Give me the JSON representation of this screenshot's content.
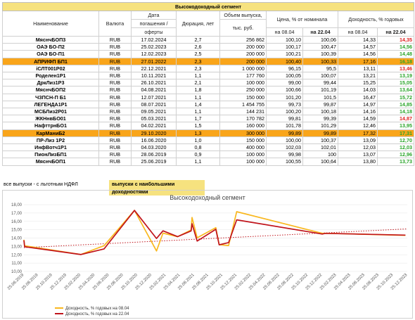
{
  "table": {
    "title": "Высокодоходный сегмент",
    "headers": {
      "name": "Наименование",
      "currency": "Валюта",
      "maturity_l1": "Дата",
      "maturity_l2": "погашения /",
      "maturity_l3": "оферты",
      "duration": "Дюрация, лет",
      "volume_l1": "Объем выпуска,",
      "volume_l2": "тыс. руб.",
      "price": "Цена, % от номинала",
      "price_d1": "на 08.04",
      "price_d2": "на 22.04",
      "yield": "Доходность, % годовых",
      "yield_d1": "на 08.04",
      "yield_d2": "на 22.04"
    },
    "rows": [
      {
        "name": "МяснчБОП3",
        "cur": "RUB",
        "date": "17.02.2024",
        "dur": "2,7",
        "vol": "256 862",
        "p1": "100,10",
        "p2": "100,06",
        "y1": "14,33",
        "y2": "14,35",
        "dir": "down",
        "hl": false
      },
      {
        "name": "ОАЭ  БО-П2",
        "cur": "RUB",
        "date": "25.02.2023",
        "dur": "2,6",
        "vol": "200 000",
        "p1": "100,17",
        "p2": "100,47",
        "y1": "14,57",
        "y2": "14,56",
        "dir": "up",
        "hl": false
      },
      {
        "name": "ОАЭ  БО-П1",
        "cur": "RUB",
        "date": "12.02.2023",
        "dur": "2,5",
        "vol": "200 000",
        "p1": "100,21",
        "p2": "100,39",
        "y1": "14,56",
        "y2": "14,48",
        "dir": "up",
        "hl": false
      },
      {
        "name": "АПРИФП БП1",
        "cur": "RUB",
        "date": "27.01.2022",
        "dur": "2,3",
        "vol": "200 000",
        "p1": "100,40",
        "p2": "100,33",
        "y1": "17,16",
        "y2": "16,18",
        "dir": "up",
        "hl": true
      },
      {
        "name": "iСЛТ001Р02",
        "cur": "RUB",
        "date": "22.12.2021",
        "dur": "2,3",
        "vol": "1 000 000",
        "p1": "96,15",
        "p2": "95,5",
        "y1": "13,11",
        "y2": "13,46",
        "dir": "down",
        "hl": false
      },
      {
        "name": "Роделен1Р1",
        "cur": "RUB",
        "date": "10.11.2021",
        "dur": "1,1",
        "vol": "177 760",
        "p1": "100,05",
        "p2": "100,07",
        "y1": "13,21",
        "y2": "13,19",
        "dir": "up",
        "hl": false
      },
      {
        "name": "ДркЛиз1Р3",
        "cur": "RUB",
        "date": "26.10.2021",
        "dur": "2,1",
        "vol": "100 000",
        "p1": "99,00",
        "p2": "99,44",
        "y1": "15,25",
        "y2": "15,05",
        "dir": "up",
        "hl": false
      },
      {
        "name": "МяснчБОП2",
        "cur": "RUB",
        "date": "04.08.2021",
        "dur": "1,8",
        "vol": "250 000",
        "p1": "100,66",
        "p2": "101,19",
        "y1": "14,03",
        "y2": "13,64",
        "dir": "up",
        "hl": false
      },
      {
        "name": "ЧЗПСН-П Б1",
        "cur": "RUB",
        "date": "12.07.2021",
        "dur": "1,1",
        "vol": "150 000",
        "p1": "101,20",
        "p2": "101,5",
        "y1": "16,47",
        "y2": "15,72",
        "dir": "up",
        "hl": false
      },
      {
        "name": "ЛЕГЕНДА1Р1",
        "cur": "RUB",
        "date": "08.07.2021",
        "dur": "1,4",
        "vol": "1 454 755",
        "p1": "99,73",
        "p2": "99,87",
        "y1": "14,97",
        "y2": "14,85",
        "dir": "up",
        "hl": false
      },
      {
        "name": "МСБЛиз2Р01",
        "cur": "RUB",
        "date": "09.05.2021",
        "dur": "1,1",
        "vol": "144 231",
        "p1": "100,20",
        "p2": "100,18",
        "y1": "14,16",
        "y2": "14,18",
        "dir": "up",
        "hl": false
      },
      {
        "name": "ЖКНнвБО01",
        "cur": "RUB",
        "date": "05.03.2021",
        "dur": "1,7",
        "vol": "170 782",
        "p1": "99,81",
        "p2": "99,39",
        "y1": "14,59",
        "y2": "14,87",
        "dir": "down",
        "hl": false
      },
      {
        "name": "НафттрнБО1",
        "cur": "RUB",
        "date": "04.02.2021",
        "dur": "1,5",
        "vol": "160 000",
        "p1": "101,78",
        "p2": "101,29",
        "y1": "12,46",
        "y2": "13,95",
        "dir": "up",
        "hl": false
      },
      {
        "name": "КарМаниБ2",
        "cur": "RUB",
        "date": "29.10.2020",
        "dur": "1,3",
        "vol": "300 000",
        "p1": "99,89",
        "p2": "99,89",
        "y1": "17,32",
        "y2": "17,31",
        "dir": "up",
        "hl": true
      },
      {
        "name": "ПР-Лиз 1Р2",
        "cur": "RUB",
        "date": "16.06.2020",
        "dur": "1,0",
        "vol": "150 000",
        "p1": "100,00",
        "p2": "100,37",
        "y1": "13,09",
        "y2": "12,70",
        "dir": "up",
        "hl": false
      },
      {
        "name": "ИнфВотч1Р1",
        "cur": "RUB",
        "date": "04.03.2020",
        "dur": "0,8",
        "vol": "400 000",
        "p1": "102,03",
        "p2": "102,01",
        "y1": "12,03",
        "y2": "12,03",
        "dir": "up",
        "hl": false
      },
      {
        "name": "ПионЛизБП1",
        "cur": "RUB",
        "date": "28.06.2019",
        "dur": "0,9",
        "vol": "100 000",
        "p1": "99,98",
        "p2": "100",
        "y1": "13,07",
        "y2": "12,96",
        "dir": "up",
        "hl": false
      },
      {
        "name": "МяснчБОП1",
        "cur": "RUB",
        "date": "25.06.2019",
        "dur": "1,1",
        "vol": "100 000",
        "p1": "100,55",
        "p2": "100,64",
        "y1": "13,80",
        "y2": "13,73",
        "dir": "up",
        "hl": false
      }
    ]
  },
  "notes": {
    "left": "все выпуски - с льготным НДФЛ",
    "right": "выпуски с наибольшими доходностями"
  },
  "colors": {
    "title_bg": "#f6e27f",
    "highlight": "#f9a51a",
    "up": "#2aa52a",
    "down": "#e02020",
    "line1": "#f9b81f",
    "line2": "#c0141b",
    "trend": "#c0141b"
  },
  "chart_data": {
    "type": "line",
    "title": "Высокодоходный сегмент",
    "ylim": [
      10,
      18
    ],
    "yticks": [
      "10,00",
      "11,00",
      "12,00",
      "13,00",
      "14,00",
      "15,00",
      "16,00",
      "17,00",
      "18,00"
    ],
    "xticks": [
      "25.06.2019",
      "25.08.2019",
      "25.10.2019",
      "25.12.2019",
      "25.02.2020",
      "25.04.2020",
      "25.06.2020",
      "25.08.2020",
      "25.10.2020",
      "25.12.2020",
      "25.02.2021",
      "25.04.2021",
      "25.06.2021",
      "25.08.2021",
      "25.10.2021",
      "25.12.2021",
      "25.02.2022",
      "25.04.2022",
      "25.06.2022",
      "25.08.2022",
      "25.10.2022",
      "25.12.2022",
      "25.02.2023",
      "25.04.2023",
      "25.06.2023",
      "25.08.2023",
      "25.10.2023",
      "25.12.2023"
    ],
    "x_start": "2019-06-25",
    "x_end": "2024-02-25",
    "series": [
      {
        "name": "Доходность, % годовых на 08.04",
        "color": "#f9b81f",
        "points": [
          [
            "2019-06-25",
            13.8
          ],
          [
            "2019-06-28",
            13.07
          ],
          [
            "2020-03-04",
            12.03
          ],
          [
            "2020-06-16",
            13.09
          ],
          [
            "2020-10-29",
            17.32
          ],
          [
            "2021-02-04",
            12.46
          ],
          [
            "2021-03-05",
            14.59
          ],
          [
            "2021-05-09",
            14.16
          ],
          [
            "2021-07-08",
            14.97
          ],
          [
            "2021-07-12",
            16.47
          ],
          [
            "2021-08-04",
            14.03
          ],
          [
            "2021-10-26",
            15.25
          ],
          [
            "2021-11-10",
            13.21
          ],
          [
            "2021-12-22",
            13.11
          ],
          [
            "2022-01-27",
            17.16
          ],
          [
            "2023-02-12",
            14.56
          ],
          [
            "2023-02-25",
            14.57
          ],
          [
            "2024-02-17",
            14.33
          ]
        ]
      },
      {
        "name": "Доходность, % годовых на 22.04",
        "color": "#c0141b",
        "points": [
          [
            "2019-06-25",
            13.73
          ],
          [
            "2019-06-28",
            12.96
          ],
          [
            "2020-03-04",
            12.03
          ],
          [
            "2020-06-16",
            12.7
          ],
          [
            "2020-10-29",
            17.31
          ],
          [
            "2021-02-04",
            13.95
          ],
          [
            "2021-03-05",
            14.87
          ],
          [
            "2021-05-09",
            14.18
          ],
          [
            "2021-07-08",
            14.85
          ],
          [
            "2021-07-12",
            15.72
          ],
          [
            "2021-08-04",
            13.64
          ],
          [
            "2021-10-26",
            15.05
          ],
          [
            "2021-11-10",
            13.19
          ],
          [
            "2021-12-22",
            13.46
          ],
          [
            "2022-01-27",
            16.18
          ],
          [
            "2023-02-12",
            14.48
          ],
          [
            "2023-02-25",
            14.56
          ],
          [
            "2024-02-17",
            14.35
          ]
        ]
      }
    ],
    "trendline": {
      "start": 12.85,
      "end": 15.1
    },
    "legend_position": "bottom-left"
  }
}
